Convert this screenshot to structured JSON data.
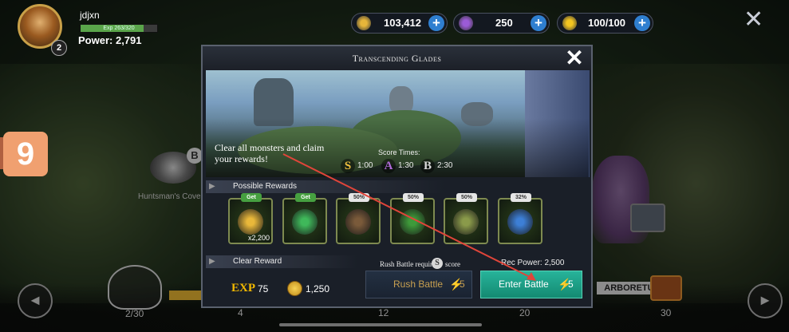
{
  "player": {
    "name": "jdjxn",
    "level": "2",
    "exp_text": "Exp 263/320",
    "exp_fraction": 0.82,
    "power_label": "Power:",
    "power_value": "2,791"
  },
  "resources": [
    {
      "name": "gold",
      "value": "103,412",
      "icon": "coin-icon",
      "color": "#e6b53a"
    },
    {
      "name": "gems",
      "value": "250",
      "icon": "purple-gem-icon",
      "color": "#9b5bd6"
    },
    {
      "name": "stamina",
      "value": "100/100",
      "icon": "lightning-icon",
      "color": "#f3c520"
    }
  ],
  "badge_number": "9",
  "map": {
    "node_left_label": "Huntsman's Cove",
    "node_left_grade": "B",
    "node_right_label": "ARBORETUM",
    "node_right_partial": "y",
    "bottom_counts": [
      "2/30",
      "4",
      "12",
      "20",
      "30"
    ]
  },
  "modal": {
    "title": "Transcending Glades",
    "close_icon": "close-icon",
    "description": "Clear all monsters and claim your rewards!",
    "score_times_label": "Score Times:",
    "score_times": [
      {
        "grade": "S",
        "time": "1:00",
        "color": "#f0c040"
      },
      {
        "grade": "A",
        "time": "1:30",
        "color": "#b06ad8"
      },
      {
        "grade": "B",
        "time": "2:30",
        "color": "#d9d9d9"
      }
    ],
    "possible_rewards_label": "Possible Rewards",
    "rewards": [
      {
        "badge": "Get",
        "icon": "gold-coin-icon",
        "qty": "x2,200",
        "color": "#e9b83a"
      },
      {
        "badge": "Get",
        "icon": "green-gem-icon",
        "qty": "",
        "color": "#3fb85a"
      },
      {
        "badge": "50%",
        "icon": "boots-icon",
        "qty": "",
        "color": "#7a5a3a"
      },
      {
        "badge": "50%",
        "icon": "amulet-icon",
        "qty": "",
        "color": "#3e9a3a"
      },
      {
        "badge": "50%",
        "icon": "ring-icon",
        "qty": "",
        "color": "#8a9a4a"
      },
      {
        "badge": "32%",
        "icon": "blue-rune-icon",
        "qty": "",
        "color": "#3d7fd6"
      }
    ],
    "clear_reward_label": "Clear Reward",
    "clear_reward_exp_label": "EXP",
    "clear_reward_exp": "75",
    "clear_reward_gold": "1,250",
    "rush_note": "Rush Battle requires",
    "rush_note_grade": "S",
    "rush_note_suffix": "score",
    "rec_power": "Rec Power: 2,500",
    "rush_button": "Rush Battle",
    "rush_cost": "5",
    "enter_button": "Enter Battle",
    "enter_cost": "5"
  }
}
